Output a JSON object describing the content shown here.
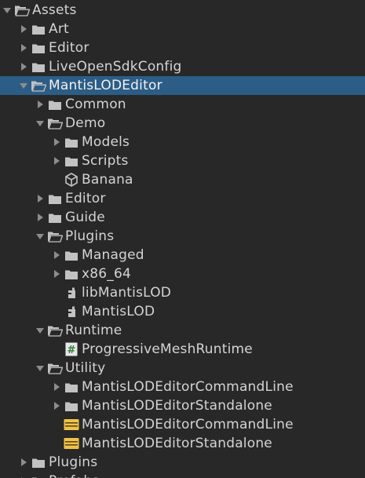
{
  "tree": [
    {
      "id": "assets",
      "label": "Assets",
      "depth": 0,
      "icon": "folder-open",
      "arrow": "expanded",
      "selected": false
    },
    {
      "id": "art",
      "label": "Art",
      "depth": 1,
      "icon": "folder",
      "arrow": "collapsed",
      "selected": false
    },
    {
      "id": "editor",
      "label": "Editor",
      "depth": 1,
      "icon": "folder",
      "arrow": "collapsed",
      "selected": false
    },
    {
      "id": "liveopensdkconfig",
      "label": "LiveOpenSdkConfig",
      "depth": 1,
      "icon": "folder",
      "arrow": "collapsed",
      "selected": false
    },
    {
      "id": "mantislodeditor",
      "label": "MantisLODEditor",
      "depth": 1,
      "icon": "folder-open",
      "arrow": "expanded",
      "selected": true
    },
    {
      "id": "common",
      "label": "Common",
      "depth": 2,
      "icon": "folder",
      "arrow": "collapsed",
      "selected": false
    },
    {
      "id": "demo",
      "label": "Demo",
      "depth": 2,
      "icon": "folder-open",
      "arrow": "expanded",
      "selected": false
    },
    {
      "id": "models",
      "label": "Models",
      "depth": 3,
      "icon": "folder",
      "arrow": "collapsed",
      "selected": false
    },
    {
      "id": "scripts",
      "label": "Scripts",
      "depth": 3,
      "icon": "folder",
      "arrow": "collapsed",
      "selected": false
    },
    {
      "id": "banana",
      "label": "Banana",
      "depth": 3,
      "icon": "unity",
      "arrow": "none",
      "selected": false
    },
    {
      "id": "demo-editor",
      "label": "Editor",
      "depth": 2,
      "icon": "folder",
      "arrow": "collapsed",
      "selected": false
    },
    {
      "id": "guide",
      "label": "Guide",
      "depth": 2,
      "icon": "folder",
      "arrow": "collapsed",
      "selected": false
    },
    {
      "id": "plugins",
      "label": "Plugins",
      "depth": 2,
      "icon": "folder-open",
      "arrow": "expanded",
      "selected": false
    },
    {
      "id": "managed",
      "label": "Managed",
      "depth": 3,
      "icon": "folder",
      "arrow": "collapsed",
      "selected": false
    },
    {
      "id": "x86-64",
      "label": "x86_64",
      "depth": 3,
      "icon": "folder",
      "arrow": "collapsed",
      "selected": false
    },
    {
      "id": "libmantislod",
      "label": "libMantisLOD",
      "depth": 3,
      "icon": "plugin",
      "arrow": "none",
      "selected": false
    },
    {
      "id": "mantislod",
      "label": "MantisLOD",
      "depth": 3,
      "icon": "plugin",
      "arrow": "none",
      "selected": false
    },
    {
      "id": "runtime",
      "label": "Runtime",
      "depth": 2,
      "icon": "folder-open",
      "arrow": "expanded",
      "selected": false
    },
    {
      "id": "progressivemeshruntime",
      "label": "ProgressiveMeshRuntime",
      "depth": 3,
      "icon": "csharp-script",
      "arrow": "none",
      "selected": false
    },
    {
      "id": "utility",
      "label": "Utility",
      "depth": 2,
      "icon": "folder-open",
      "arrow": "expanded",
      "selected": false
    },
    {
      "id": "cmdline-folder",
      "label": "MantisLODEditorCommandLine",
      "depth": 3,
      "icon": "folder",
      "arrow": "collapsed",
      "selected": false
    },
    {
      "id": "standalone-folder",
      "label": "MantisLODEditorStandalone",
      "depth": 3,
      "icon": "folder",
      "arrow": "collapsed",
      "selected": false
    },
    {
      "id": "cmdline-asmdef",
      "label": "MantisLODEditorCommandLine",
      "depth": 3,
      "icon": "assembly-definition",
      "arrow": "none",
      "selected": false
    },
    {
      "id": "standalone-asmdef",
      "label": "MantisLODEditorStandalone",
      "depth": 3,
      "icon": "assembly-definition",
      "arrow": "none",
      "selected": false
    },
    {
      "id": "plugins-root",
      "label": "Plugins",
      "depth": 1,
      "icon": "folder",
      "arrow": "collapsed",
      "selected": false
    },
    {
      "id": "prefabs-partial",
      "label": "Prefabs",
      "depth": 1,
      "icon": "folder",
      "arrow": "collapsed",
      "selected": false
    }
  ],
  "colors": {
    "background": "#282828",
    "selection": "#2c5d87",
    "text": "#d4d4d4",
    "icon": "#c2c2c2",
    "arrow": "#8d8d8d",
    "asmdef": "#f0c24a"
  }
}
